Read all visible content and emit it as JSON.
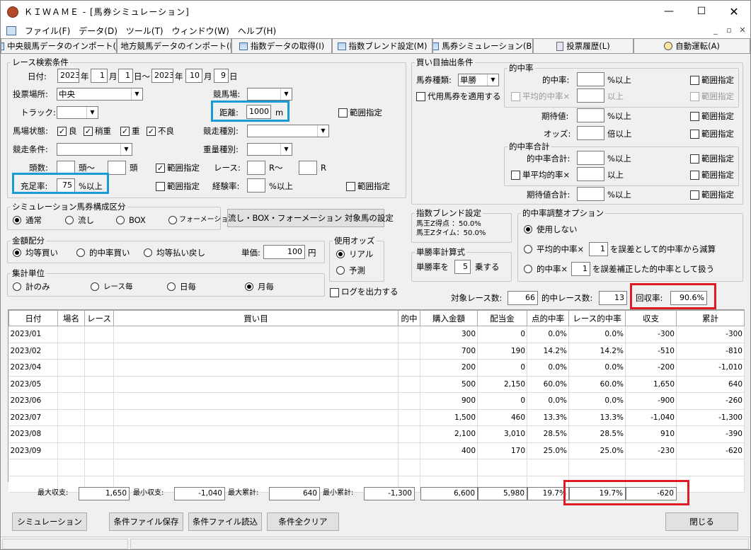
{
  "window": {
    "title": "ＫＩＷＡＭＥ - [馬券シミュレーション]"
  },
  "menu": [
    "ファイル(F)",
    "データ(D)",
    "ツール(T)",
    "ウィンドウ(W)",
    "ヘルプ(H)"
  ],
  "toolbar": [
    "中央競馬データのインポート(J)",
    "地方競馬データのインポート(N)",
    "指数データの取得(I)",
    "指数ブレンド設定(M)",
    "馬券シミュレーション(B)",
    "投票履歴(L)",
    "自動運転(A)"
  ],
  "search": {
    "title": "レース検索条件",
    "date_label": "日付:",
    "from_year": "2023",
    "from_month": "1",
    "from_day": "1",
    "to_year": "2023",
    "to_month": "10",
    "to_day": "9",
    "year": "年",
    "month": "月",
    "day": "日",
    "tilde": "日～",
    "venue_label": "投票場所:",
    "venue": "中央",
    "track_course_label": "競馬場:",
    "track_label": "トラック:",
    "distance_label": "距離:",
    "distance": "1000",
    "distance_unit": "m",
    "range": "範囲指定",
    "cond_label": "馬場状態:",
    "cond": [
      "良",
      "稍重",
      "重",
      "不良"
    ],
    "race_type_label": "競走種別:",
    "race_cond_label": "競走条件:",
    "weight_label": "重量種別:",
    "heads_label": "頭数:",
    "heads_mid": "頭～",
    "heads_end": "頭",
    "race_label": "レース:",
    "race_mid": "R～",
    "race_end": "R",
    "fill_label": "充足率:",
    "fill": "75",
    "fill_unit": "%以上",
    "exp_label": "経験率:",
    "exp_unit": "%以上"
  },
  "composition": {
    "title": "シミュレーション馬券構成区分",
    "options": [
      "通常",
      "流し",
      "BOX",
      "フォーメーション"
    ],
    "set_button": "流し・BOX・フォーメーション 対象馬の設定"
  },
  "money": {
    "title": "金額配分",
    "options": [
      "均等買い",
      "的中率買い",
      "均等払い戻し"
    ],
    "unit_label": "単価:",
    "unit_value": "100",
    "unit_yen": "円"
  },
  "odds": {
    "title": "使用オッズ",
    "options": [
      "リアル",
      "予測"
    ]
  },
  "aggregate": {
    "title": "集計単位",
    "options": [
      "計のみ",
      "レース毎",
      "日毎",
      "月毎"
    ]
  },
  "log_label": "ログを出力する",
  "extract": {
    "title": "買い目抽出条件",
    "type_label": "馬券種類:",
    "type": "単勝",
    "substitute": "代用馬券を適用する",
    "hit_title": "的中率",
    "hit_label": "的中率:",
    "hit_unit": "%以上",
    "avg_hit_label": "平均的中率×",
    "avg_hit_unit": "以上",
    "exp_label": "期待値:",
    "exp_unit": "%以上",
    "odds_label": "オッズ:",
    "odds_unit": "倍以上",
    "sum_title": "的中率合計",
    "sum_label": "的中率合計:",
    "sum_unit": "%以上",
    "single_avg_label": "単平均的率×",
    "single_avg_unit": "以上",
    "exp_sum_label": "期待値合計:",
    "exp_sum_unit": "%以上",
    "range": "範囲指定"
  },
  "blend": {
    "title": "指数ブレンド設定",
    "line1": "馬王Z得点 ：50.0%",
    "line2": "馬王Zタイム：50.0%"
  },
  "win_rate": {
    "title": "単勝率計算式",
    "label": "単勝率を",
    "value": "5",
    "unit": "乗する"
  },
  "adjust": {
    "title": "的中率調整オプション",
    "opt1": "使用しない",
    "opt2a": "平均的中率×",
    "opt2v": "1",
    "opt2b": "を誤差として的中率から減算",
    "opt3a": "的中率×",
    "opt3v": "1",
    "opt3b": "を誤差補正した的中率として扱う"
  },
  "stats": {
    "races_label": "対象レース数:",
    "races": "66",
    "hit_label": "的中レース数:",
    "hits": "13",
    "return_label": "回収率:",
    "return": "90.6%"
  },
  "table": {
    "headers": [
      "日付",
      "場名",
      "レース",
      "買い目",
      "的中",
      "購入金額",
      "配当金",
      "点的中率",
      "レース的中率",
      "収支",
      "累計"
    ],
    "rows": [
      [
        "2023/01",
        "300",
        "0",
        "0.0%",
        "0.0%",
        "-300",
        "-300"
      ],
      [
        "2023/02",
        "700",
        "190",
        "14.2%",
        "14.2%",
        "-510",
        "-810"
      ],
      [
        "2023/04",
        "200",
        "0",
        "0.0%",
        "0.0%",
        "-200",
        "-1,010"
      ],
      [
        "2023/05",
        "500",
        "2,150",
        "60.0%",
        "60.0%",
        "1,650",
        "640"
      ],
      [
        "2023/06",
        "900",
        "0",
        "0.0%",
        "0.0%",
        "-900",
        "-260"
      ],
      [
        "2023/07",
        "1,500",
        "460",
        "13.3%",
        "13.3%",
        "-1,040",
        "-1,300"
      ],
      [
        "2023/08",
        "2,100",
        "3,010",
        "28.5%",
        "28.5%",
        "910",
        "-390"
      ],
      [
        "2023/09",
        "400",
        "170",
        "25.0%",
        "25.0%",
        "-230",
        "-620"
      ]
    ]
  },
  "summary": {
    "max_label": "最大収支:",
    "max": "1,650",
    "min_label": "最小収支:",
    "min": "-1,040",
    "maxcum_label": "最大累計:",
    "maxcum": "640",
    "mincum_label": "最小累計:",
    "mincum": "-1,300",
    "purchase": "6,600",
    "payout": "5,980",
    "point_rate": "19.7%",
    "race_rate": "19.7%",
    "total": "-620"
  },
  "buttons": {
    "simulate": "シミュレーション",
    "save": "条件ファイル保存",
    "load": "条件ファイル読込",
    "clear": "条件全クリア",
    "close": "閉じる"
  },
  "colors": {
    "highlight_blue": "#1a9ad6",
    "highlight_red": "#e01a22"
  }
}
